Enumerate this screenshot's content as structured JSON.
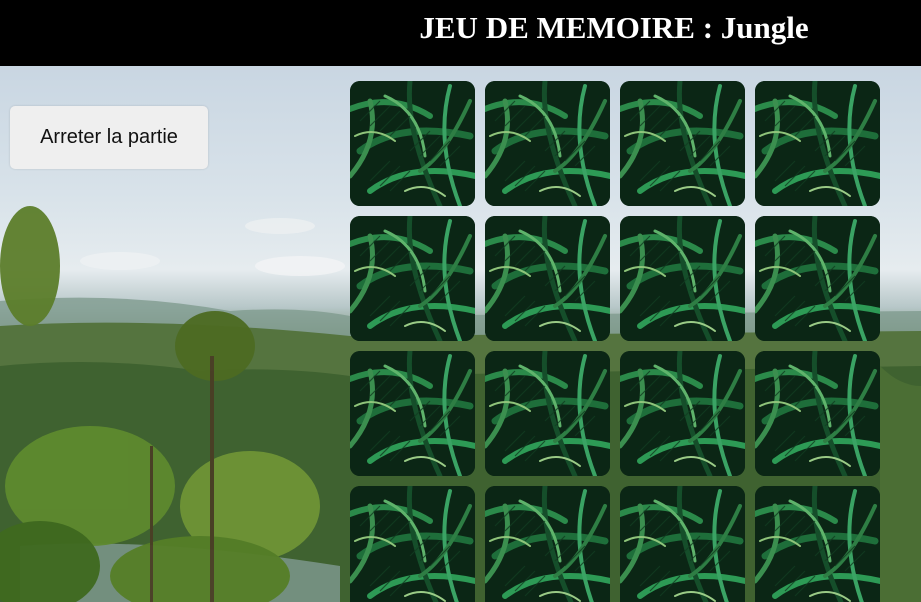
{
  "header": {
    "title": "JEU DE MEMOIRE : Jungle"
  },
  "controls": {
    "stop_button_label": "Arreter la partie"
  },
  "board": {
    "theme": "Jungle",
    "card_back_icon": "palm-leaves-icon",
    "rows": 4,
    "columns": 4,
    "cards_face_down": 16
  },
  "colors": {
    "header_bg": "#000000",
    "header_text": "#ffffff",
    "button_bg": "#efefef",
    "card_dark": "#0c2a17",
    "card_leaf": "#1e7a3c"
  }
}
